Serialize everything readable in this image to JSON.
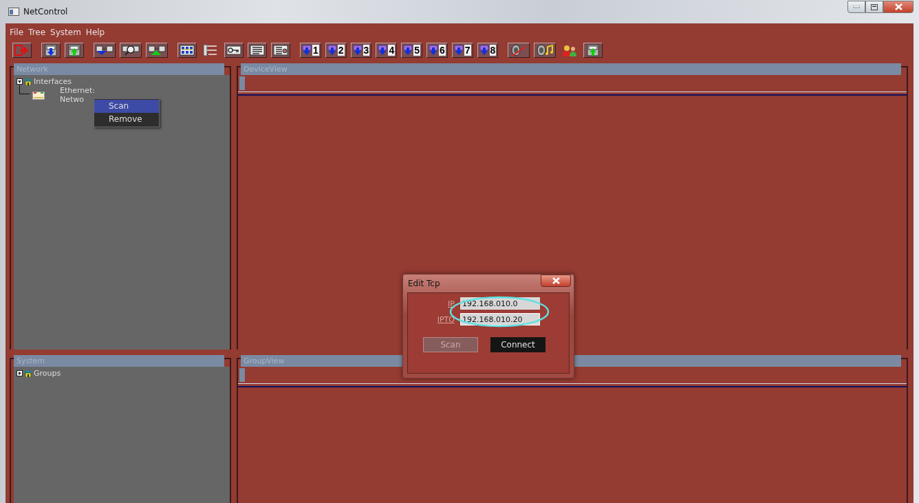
{
  "window": {
    "title": "NetControl"
  },
  "menu": [
    "File",
    "Tree",
    "System",
    "Help"
  ],
  "toolbar": [
    {
      "kind": "exit"
    },
    {
      "kind": "download"
    },
    {
      "kind": "upload"
    },
    {
      "kind": "net-down"
    },
    {
      "kind": "net-search"
    },
    {
      "kind": "net-up"
    },
    {
      "kind": "grid"
    },
    {
      "kind": "tree"
    },
    {
      "kind": "key"
    },
    {
      "kind": "list"
    },
    {
      "kind": "list-detail"
    },
    {
      "kind": "numbered",
      "label": "1"
    },
    {
      "kind": "numbered",
      "label": "2"
    },
    {
      "kind": "numbered",
      "label": "3"
    },
    {
      "kind": "numbered",
      "label": "4"
    },
    {
      "kind": "numbered",
      "label": "5"
    },
    {
      "kind": "numbered",
      "label": "6"
    },
    {
      "kind": "numbered",
      "label": "7"
    },
    {
      "kind": "numbered",
      "label": "8"
    },
    {
      "kind": "mute"
    },
    {
      "kind": "music"
    },
    {
      "kind": "users"
    },
    {
      "kind": "upload"
    }
  ],
  "network_panel": {
    "title": "Network",
    "tree": [
      {
        "label": "Interfaces",
        "expanded": true,
        "children": [
          {
            "lines": [
              "Ethernet:",
              "Netwo"
            ]
          }
        ]
      }
    ]
  },
  "context_menu": [
    {
      "label": "Scan",
      "selected": true
    },
    {
      "label": "Remove",
      "selected": false
    }
  ],
  "device_view": {
    "title": "DeviceView"
  },
  "system_panel": {
    "title": "System",
    "tree": [
      {
        "label": "Groups",
        "expanded": false
      }
    ]
  },
  "group_view": {
    "title": "GroupView"
  },
  "dialog": {
    "title": "Edit Tcp",
    "fields": [
      {
        "label": "IP",
        "value": "192.168.010.0",
        "focused": false
      },
      {
        "label": "IPTO",
        "value": "192.168.010.20",
        "focused": true
      }
    ],
    "buttons": [
      {
        "label": "Scan",
        "kind": "secondary"
      },
      {
        "label": "Connect",
        "kind": "primary"
      }
    ]
  }
}
